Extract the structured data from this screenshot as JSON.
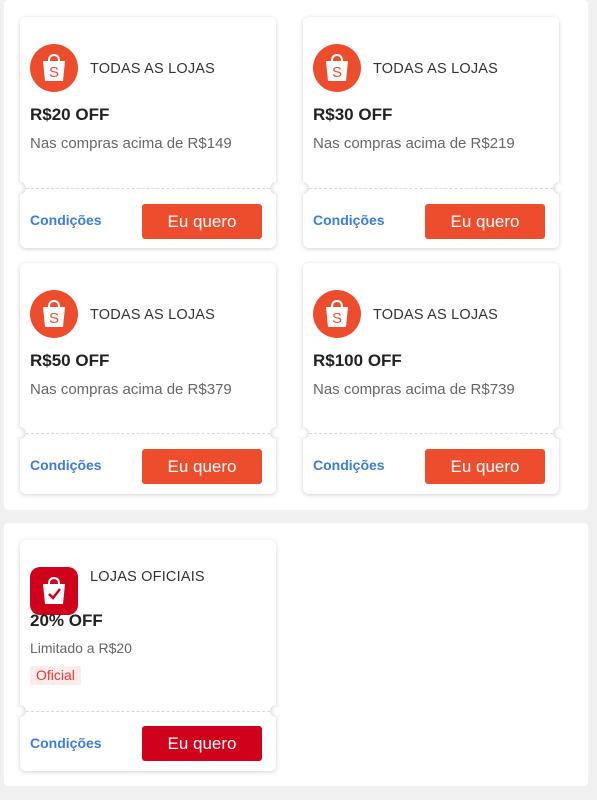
{
  "group_all_stores": {
    "coupons": [
      {
        "store": "TODAS AS LOJAS",
        "amount": "R$20 OFF",
        "condition": "Nas compras acima de R$149",
        "link": "Condições",
        "button": "Eu quero"
      },
      {
        "store": "TODAS AS LOJAS",
        "amount": "R$30 OFF",
        "condition": "Nas compras acima de R$219",
        "link": "Condições",
        "button": "Eu quero"
      },
      {
        "store": "TODAS AS LOJAS",
        "amount": "R$50 OFF",
        "condition": "Nas compras acima de R$379",
        "link": "Condições",
        "button": "Eu quero"
      },
      {
        "store": "TODAS AS LOJAS",
        "amount": "R$100 OFF",
        "condition": "Nas compras acima de R$739",
        "link": "Condições",
        "button": "Eu quero"
      }
    ]
  },
  "group_official": {
    "coupons": [
      {
        "store": "LOJAS OFICIAIS",
        "amount": "20% OFF",
        "condition": "Limitado a R$20",
        "badge": "Oficial",
        "link": "Condições",
        "button": "Eu quero"
      }
    ]
  },
  "icons": {
    "shopee_logo": "shopee-bag-icon",
    "official_logo": "official-store-bag-icon"
  },
  "colors": {
    "shopee_orange": "#ee4d2d",
    "official_red": "#d0011b",
    "link_blue": "#3b7dd8",
    "badge_red": "#e53935"
  }
}
